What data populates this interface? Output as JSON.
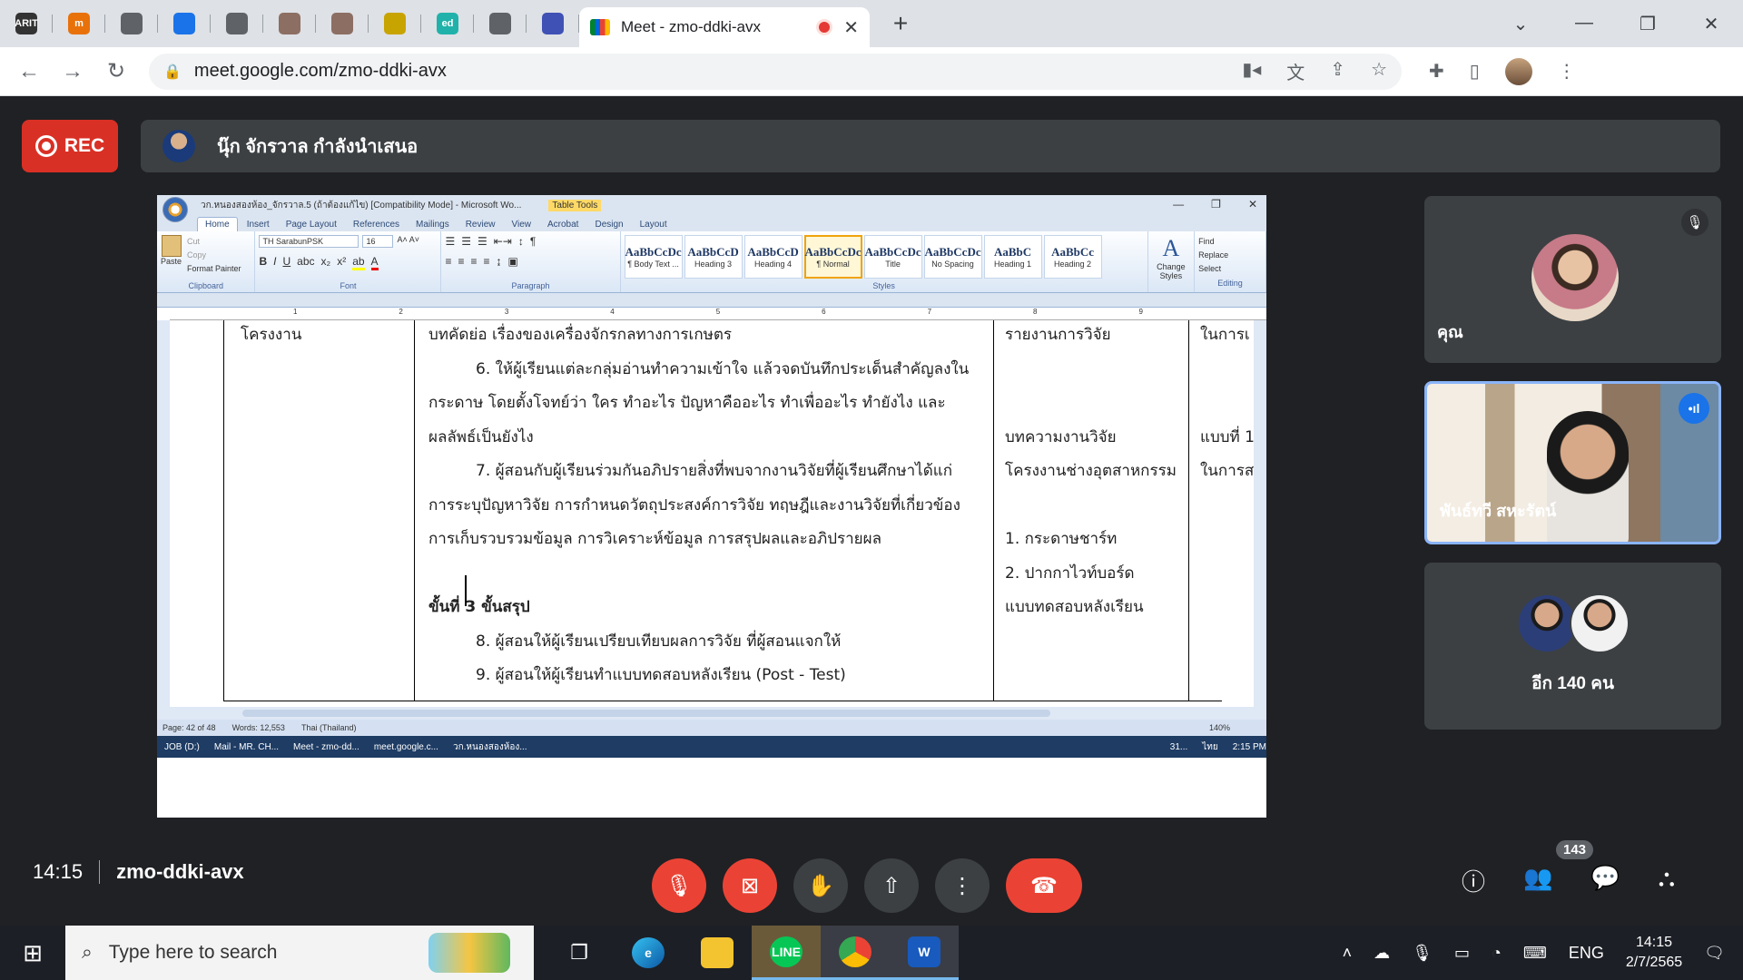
{
  "browser": {
    "pinned_tabs": [
      {
        "icon": "arit-icon",
        "text": "ARIT",
        "color": "#333333"
      },
      {
        "icon": "app-icon",
        "text": "m",
        "color": "#e8710a"
      },
      {
        "icon": "globe-icon",
        "text": "",
        "color": "#5f6368"
      },
      {
        "icon": "ring-icon",
        "text": "",
        "color": "#1a73e8"
      },
      {
        "icon": "globe-icon",
        "text": "",
        "color": "#5f6368"
      },
      {
        "icon": "person-icon",
        "text": "",
        "color": "#8d6e63"
      },
      {
        "icon": "person-icon",
        "text": "",
        "color": "#8d6e63"
      },
      {
        "icon": "seal-icon",
        "text": "",
        "color": "#c8a400"
      },
      {
        "icon": "ed-icon",
        "text": "ed",
        "color": "#20b2aa"
      },
      {
        "icon": "globe-icon",
        "text": "",
        "color": "#5f6368"
      },
      {
        "icon": "forms-icon",
        "text": "",
        "color": "#3f51b5"
      }
    ],
    "active_tab": {
      "title": "Meet - zmo-ddki-avx"
    },
    "url": "meet.google.com/zmo-ddki-avx"
  },
  "meet": {
    "rec_label": "REC",
    "presenting": "นุ๊ก จักรวาล กำลังนำเสนอ",
    "time": "14:15",
    "code": "zmo-ddki-avx",
    "participants_count": "143",
    "tiles": [
      {
        "name": "คุณ"
      },
      {
        "name": "พันธ์ทวี สหะรัตน์"
      },
      {
        "more": "อีก 140 คน"
      }
    ]
  },
  "word": {
    "title": "วก.หนองสองห้อง_จักรวาล.5 (ถ้าต้องแก้ไข) [Compatibility Mode] - Microsoft Wo...",
    "table_tools": "Table Tools",
    "ribbon_tabs": [
      "Home",
      "Insert",
      "Page Layout",
      "References",
      "Mailings",
      "Review",
      "View",
      "Acrobat",
      "Design",
      "Layout"
    ],
    "clipboard": {
      "paste": "Paste",
      "cut": "Cut",
      "copy": "Copy",
      "format_painter": "Format Painter",
      "label": "Clipboard"
    },
    "font": {
      "name": "TH SarabunPSK",
      "size": "16",
      "label": "Font"
    },
    "paragraph_label": "Paragraph",
    "styles": [
      {
        "sample": "AaBbCcDc",
        "name": "¶ Body Text ..."
      },
      {
        "sample": "AaBbCcD",
        "name": "Heading 3"
      },
      {
        "sample": "AaBbCcD",
        "name": "Heading 4"
      },
      {
        "sample": "AaBbCcDc",
        "name": "¶ Normal"
      },
      {
        "sample": "AaBbCcDc",
        "name": "Title"
      },
      {
        "sample": "AaBbCcDc",
        "name": "No Spacing"
      },
      {
        "sample": "AaBbC",
        "name": "Heading 1"
      },
      {
        "sample": "AaBbCc",
        "name": "Heading 2"
      }
    ],
    "styles_label": "Styles",
    "change_styles": "Change Styles",
    "editing": {
      "find": "Find",
      "replace": "Replace",
      "select": "Select",
      "label": "Editing"
    },
    "ruler_marks": [
      "1",
      "2",
      "3",
      "4",
      "5",
      "6",
      "7",
      "8",
      "9"
    ],
    "doc": {
      "col1": [
        "โครงงาน"
      ],
      "col2": [
        "บทคัดย่อ เรื่องของเครื่องจักรกลทางการเกษตร",
        "6. ให้ผู้เรียนแต่ละกลุ่มอ่านทำความเข้าใจ แล้วจดบันทึกประเด็นสำคัญลงใน",
        "กระดาษ โดยตั้งโจทย์ว่า ใคร ทำอะไร ปัญหาคืออะไร ทำเพื่ออะไร ทำยังไง และ",
        "ผลลัพธ์เป็นยังไง",
        "7. ผู้สอนกับผู้เรียนร่วมกันอภิปรายสิ่งที่พบจากงานวิจัยที่ผู้เรียนศึกษาได้แก่",
        "การระบุปัญหาวิจัย การกำหนดวัตถุประสงค์การวิจัย ทฤษฎีและงานวิจัยที่เกี่ยวข้อง",
        "การเก็บรวบรวมข้อมูล การวิเคราะห์ข้อมูล การสรุปผลและอภิปรายผล",
        "ขั้นที่ 3 ขั้นสรุป",
        "8. ผู้สอนให้ผู้เรียนเปรียบเทียบผลการวิจัย ที่ผู้สอนแจกให้",
        "9. ผู้สอนให้ผู้เรียนทำแบบทดสอบหลังเรียน (Post - Test)"
      ],
      "col3": [
        "รายงานการวิจัย",
        "บทความงานวิจัย",
        "โครงงานช่างอุตสาหกรรม",
        "1. กระดาษชาร์ท",
        "2. ปากกาไวท์บอร์ด",
        "แบบทดสอบหลังเรียน"
      ],
      "col4": [
        "ในการเ",
        "แบบที่ 1",
        "ในการส"
      ]
    },
    "status": {
      "page": "Page: 42 of 48",
      "words": "Words: 12,553",
      "lang": "Thai (Thailand)",
      "zoom": "140%"
    },
    "taskbar": [
      "JOB (D:)",
      "Mail - MR. CH...",
      "Meet - zmo-dd...",
      "meet.google.c...",
      "วก.หนองสองห้อง...",
      "31...",
      "ไทย",
      "2:15 PM"
    ]
  },
  "windows": {
    "search_placeholder": "Type here to search",
    "lang": "ENG",
    "time": "14:15",
    "date": "2/7/2565"
  }
}
